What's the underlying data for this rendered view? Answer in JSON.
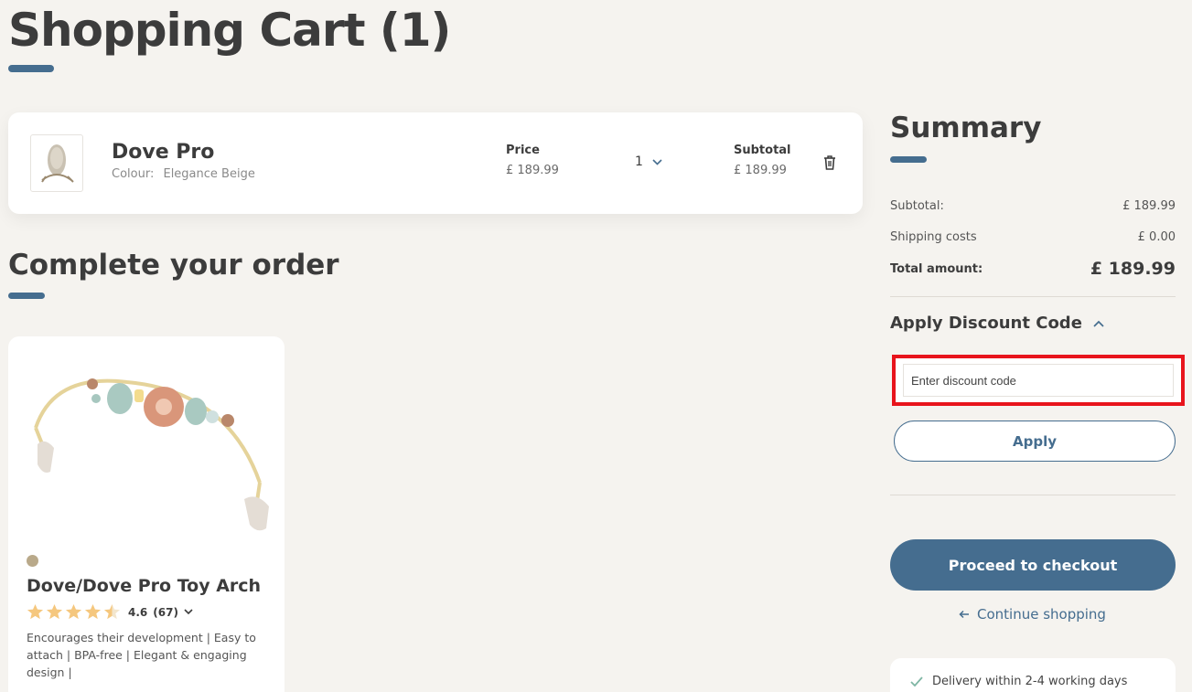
{
  "page": {
    "title": "Shopping Cart (1)"
  },
  "cart_item": {
    "name": "Dove Pro",
    "colour_label": "Colour:",
    "colour_value": "Elegance Beige",
    "price_label": "Price",
    "price_value": "£  189.99",
    "quantity": "1",
    "subtotal_label": "Subtotal",
    "subtotal_value": "£  189.99"
  },
  "complete_order": {
    "heading": "Complete your order",
    "product": {
      "name": "Dove/Dove Pro Toy Arch",
      "rating": "4.6",
      "rating_count": "(67)",
      "stars_filled": 4.5,
      "description": "Encourages their development | Easy to attach | BPA-free | Elegant & engaging design |"
    }
  },
  "summary": {
    "heading": "Summary",
    "subtotal_label": "Subtotal:",
    "subtotal_value": "£  189.99",
    "shipping_label": "Shipping costs",
    "shipping_value": "£  0.00",
    "total_label": "Total amount:",
    "total_value": "£  189.99",
    "discount_heading": "Apply Discount Code",
    "discount_placeholder": "Enter discount code",
    "apply_label": "Apply",
    "checkout_label": "Proceed to checkout",
    "continue_label": "Continue shopping",
    "usp_delivery": "Delivery within 2-4 working days"
  },
  "colors": {
    "accent": "#456d8f",
    "highlight": "#e8141c",
    "star": "#f5c77e"
  }
}
